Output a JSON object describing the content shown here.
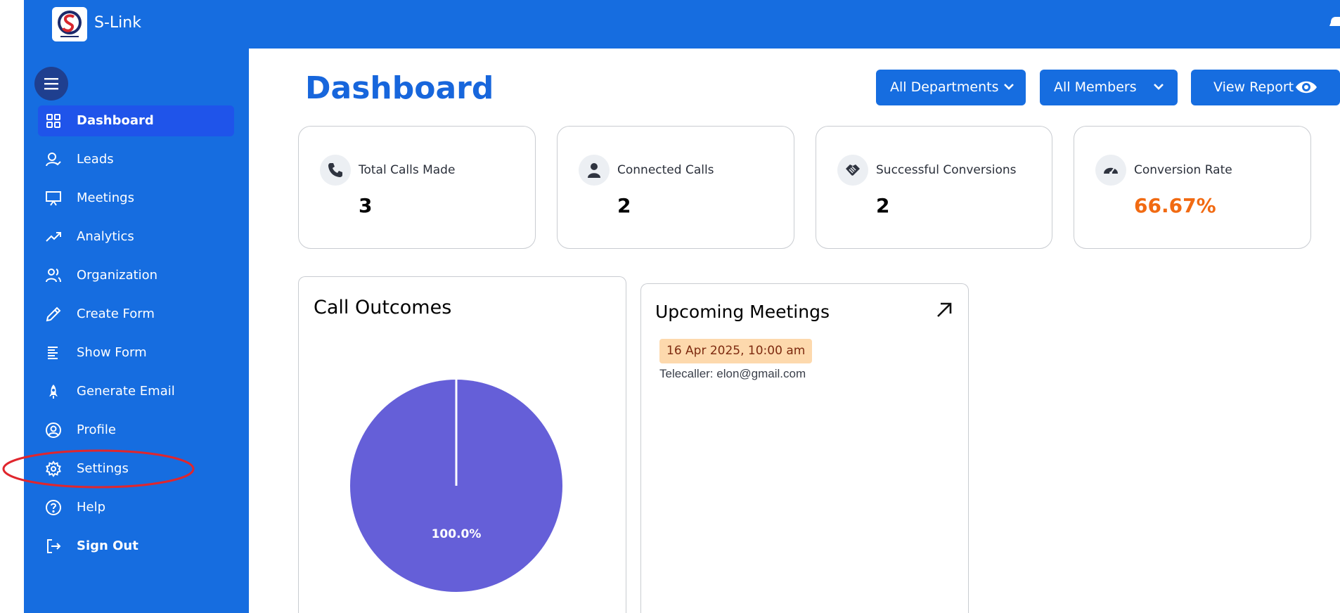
{
  "app": {
    "title": "S-Link"
  },
  "sidebar": {
    "items": [
      {
        "label": "Dashboard",
        "icon": "grid-icon",
        "active": true
      },
      {
        "label": "Leads",
        "icon": "user-icon"
      },
      {
        "label": "Meetings",
        "icon": "presentation-icon"
      },
      {
        "label": "Analytics",
        "icon": "trending-up-icon"
      },
      {
        "label": "Organization",
        "icon": "users-icon"
      },
      {
        "label": "Create Form",
        "icon": "pencil-icon"
      },
      {
        "label": "Show Form",
        "icon": "align-left-icon"
      },
      {
        "label": "Generate Email",
        "icon": "rocket-icon"
      },
      {
        "label": "Profile",
        "icon": "user-circle-icon"
      },
      {
        "label": "Settings",
        "icon": "gear-icon",
        "highlighted": true
      },
      {
        "label": "Help",
        "icon": "help-circle-icon"
      },
      {
        "label": "Sign Out",
        "icon": "sign-out-icon"
      }
    ]
  },
  "main": {
    "title": "Dashboard",
    "filters": {
      "department": "All Departments",
      "members": "All Members",
      "report": "View Report"
    },
    "stats": [
      {
        "label": "Total Calls Made",
        "value": "3",
        "icon": "phone-icon"
      },
      {
        "label": "Connected Calls",
        "value": "2",
        "icon": "person-icon"
      },
      {
        "label": "Successful Conversions",
        "value": "2",
        "icon": "handshake-icon"
      },
      {
        "label": "Conversion Rate",
        "value": "66.67%",
        "icon": "gauge-icon"
      }
    ],
    "call_outcomes": {
      "title": "Call Outcomes",
      "slice_label": "100.0%"
    },
    "meetings": {
      "title": "Upcoming Meetings",
      "items": [
        {
          "date": "16 Apr 2025, 10:00 am",
          "caller": "Telecaller: elon@gmail.com"
        }
      ]
    }
  },
  "colors": {
    "primary": "#166de0",
    "active_nav": "#1f54ea",
    "accent_orange": "#f16a12",
    "pie": "#655fd8",
    "highlight_ring": "#e0262d"
  },
  "chart_data": {
    "type": "pie",
    "title": "Call Outcomes",
    "slices": [
      {
        "label": "",
        "value": 100.0
      }
    ]
  }
}
